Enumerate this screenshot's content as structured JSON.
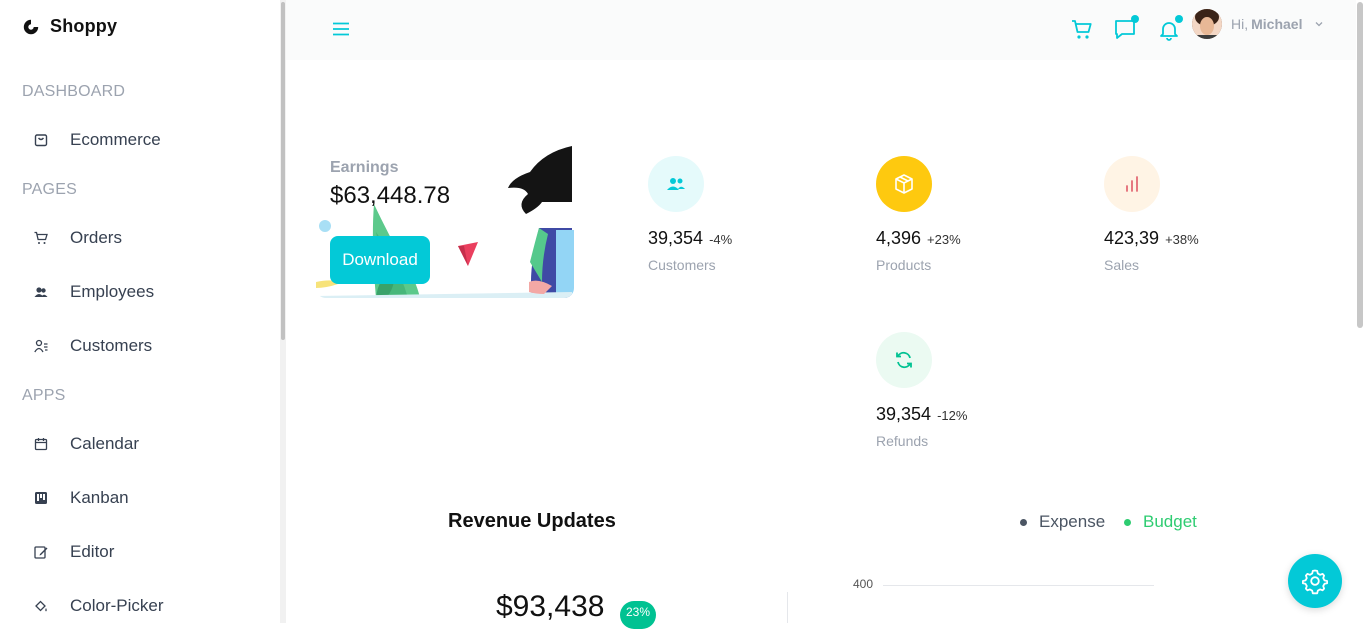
{
  "brand": {
    "name": "Shoppy"
  },
  "sidebar": {
    "sections": [
      {
        "title": "DASHBOARD",
        "items": [
          {
            "label": "Ecommerce",
            "icon": "shopping-bag-icon"
          }
        ]
      },
      {
        "title": "PAGES",
        "items": [
          {
            "label": "Orders",
            "icon": "cart-icon"
          },
          {
            "label": "Employees",
            "icon": "employees-icon"
          },
          {
            "label": "Customers",
            "icon": "customers-icon"
          }
        ]
      },
      {
        "title": "APPS",
        "items": [
          {
            "label": "Calendar",
            "icon": "calendar-icon"
          },
          {
            "label": "Kanban",
            "icon": "kanban-icon"
          },
          {
            "label": "Editor",
            "icon": "edit-icon"
          },
          {
            "label": "Color-Picker",
            "icon": "paint-bucket-icon"
          }
        ]
      }
    ]
  },
  "topbar": {
    "greeting": "Hi,",
    "user_name": "Michael",
    "icons": [
      "menu-icon",
      "cart-icon",
      "chat-icon",
      "bell-icon",
      "chevron-down-icon"
    ]
  },
  "earnings": {
    "label": "Earnings",
    "value": "$63,448.78",
    "download_label": "Download"
  },
  "stats": [
    {
      "value": "39,354",
      "pct": "-4%",
      "label": "Customers",
      "icon": "customers-icon",
      "bg": "#E5FAFB",
      "color": "#03C9D7"
    },
    {
      "value": "4,396",
      "pct": "+23%",
      "label": "Products",
      "icon": "box-icon",
      "bg": "#FEC90F",
      "color": "#ffffff"
    },
    {
      "value": "423,39",
      "pct": "+38%",
      "label": "Sales",
      "icon": "bar-chart-icon",
      "bg": "#FFF4E5",
      "color": "#E46A76"
    },
    {
      "value": "39,354",
      "pct": "-12%",
      "label": "Refunds",
      "icon": "refresh-icon",
      "bg": "#EBFAF2",
      "color": "#00C292"
    }
  ],
  "revenue": {
    "title": "Revenue Updates",
    "legend": [
      {
        "label": "Expense",
        "color": "#4B5563"
      },
      {
        "label": "Budget",
        "color": "#2ECC71"
      }
    ],
    "amount": "$93,438",
    "badge": "23%",
    "axis_top": "400"
  },
  "colors": {
    "accent": "#03C9D7"
  }
}
